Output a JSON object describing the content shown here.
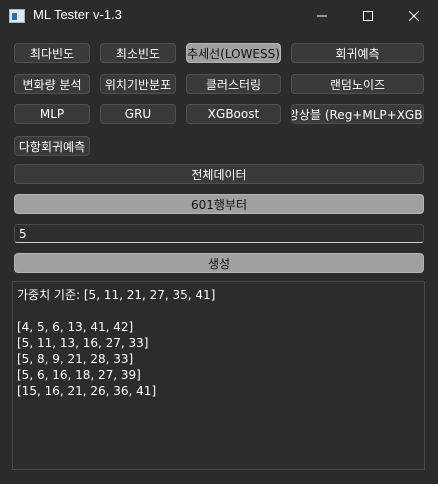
{
  "window": {
    "title": "ML Tester v-1.3"
  },
  "buttons": {
    "row1": [
      "최다빈도",
      "최소빈도",
      "추세선(LOWESS)",
      "회귀예측"
    ],
    "row2": [
      "변화량 분석",
      "위치기반분포",
      "클러스터링",
      "랜덤노이즈"
    ],
    "row3": [
      "MLP",
      "GRU",
      "XGBoost",
      "앙상블 (Reg+MLP+XGB)"
    ],
    "row4": [
      "다항회귀예측"
    ],
    "all_data": "전체데이터",
    "from_row": "601행부터",
    "generate": "생성"
  },
  "input": {
    "value": "5"
  },
  "output": {
    "weights_line": "가중치 기준: [5, 11, 21, 27, 35, 41]",
    "results": [
      "[4, 5, 6, 13, 41, 42]",
      "[5, 11, 13, 16, 27, 33]",
      "[5, 8, 9, 21, 28, 33]",
      "[5, 6, 16, 18, 27, 39]",
      "[15, 16, 21, 26, 36, 41]"
    ]
  }
}
